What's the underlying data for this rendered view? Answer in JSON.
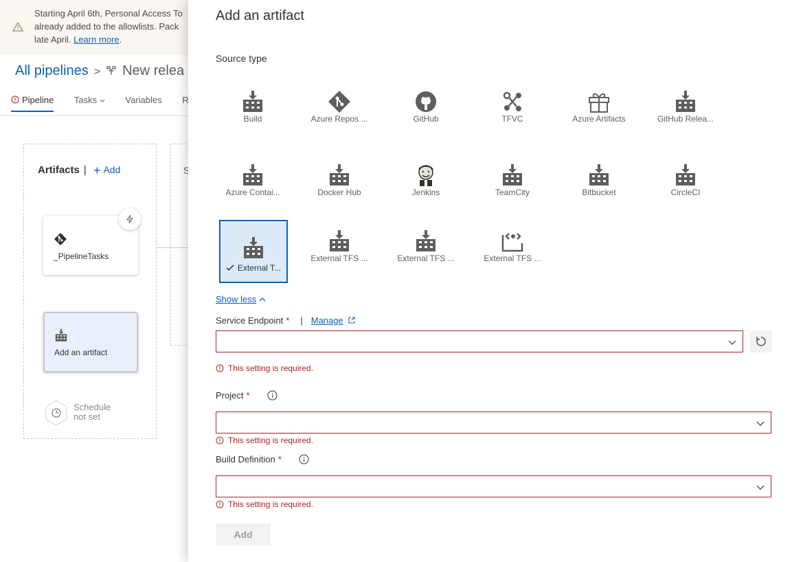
{
  "background": {
    "banner": {
      "line1": "Starting April 6th, Personal Access To",
      "line2": "already added to the allowlists. Pack",
      "line3_prefix": "late April. ",
      "learn_more": "Learn more",
      "line3_suffix": "."
    },
    "breadcrumb": {
      "all_pipelines": "All pipelines",
      "separator": ">",
      "release_name": "New relea"
    },
    "tabs": [
      {
        "label": "Pipeline",
        "active": true
      },
      {
        "label": "Tasks",
        "chevron": true
      },
      {
        "label": "Variables"
      },
      {
        "label": "R"
      }
    ],
    "artifacts": {
      "heading": "Artifacts",
      "divider": "|",
      "add_label": "Add",
      "artifact_name": "_PipelineTasks",
      "add_artifact_label": "Add an artifact",
      "schedule_line1": "Schedule",
      "schedule_line2": "not set"
    },
    "stage_initial": "S"
  },
  "panel": {
    "title": "Add an artifact",
    "source_type_label": "Source type",
    "source_types": [
      {
        "label": "Build",
        "icon": "build-icon"
      },
      {
        "label": "Azure Repos ...",
        "icon": "azure-repos-icon"
      },
      {
        "label": "GitHub",
        "icon": "github-icon"
      },
      {
        "label": "TFVC",
        "icon": "tfvc-icon"
      },
      {
        "label": "Azure Artifacts",
        "icon": "azure-artifacts-icon"
      },
      {
        "label": "GitHub Relea...",
        "icon": "build-icon"
      },
      {
        "label": "Azure Contai...",
        "icon": "build-icon"
      },
      {
        "label": "Docker Hub",
        "icon": "build-icon"
      },
      {
        "label": "Jenkins",
        "icon": "jenkins-icon"
      },
      {
        "label": "TeamCity",
        "icon": "build-icon"
      },
      {
        "label": "Bitbucket",
        "icon": "build-icon"
      },
      {
        "label": "CircleCI",
        "icon": "build-icon"
      },
      {
        "label": "External T...",
        "icon": "build-icon",
        "selected": true
      },
      {
        "label": "External TFS ...",
        "icon": "build-icon"
      },
      {
        "label": "External TFS ...",
        "icon": "build-icon"
      },
      {
        "label": "External TFS ...",
        "icon": "external-tfs-icon"
      }
    ],
    "show_less": "Show less",
    "service_endpoint": {
      "label": "Service Endpoint",
      "required": "*",
      "divider": "|",
      "manage": "Manage",
      "value": "",
      "error": "This setting is required."
    },
    "project": {
      "label": "Project",
      "required": "*",
      "value": "",
      "error": "This setting is required."
    },
    "build_definition": {
      "label": "Build Definition",
      "required": "*",
      "value": "",
      "error": "This setting is required."
    },
    "add_button": "Add"
  },
  "colors": {
    "accent": "#0e62b0",
    "error": "#a4262c",
    "selected_bg": "#dbe9f8",
    "banner_bg": "#faf6f1"
  }
}
